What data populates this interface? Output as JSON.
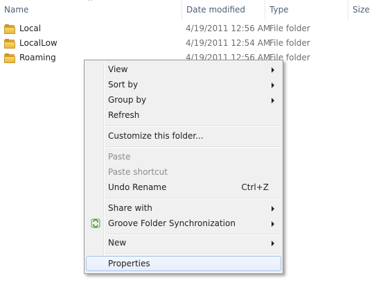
{
  "columns": {
    "name": "Name",
    "date_modified": "Date modified",
    "type": "Type",
    "size": "Size",
    "sort_indicator": "^"
  },
  "files": [
    {
      "name": "Local",
      "date_modified": "4/19/2011 12:56 AM",
      "type": "File folder",
      "icon": "folder-icon"
    },
    {
      "name": "LocalLow",
      "date_modified": "4/19/2011 12:54 AM",
      "type": "File folder",
      "icon": "folder-icon"
    },
    {
      "name": "Roaming",
      "date_modified": "4/19/2011 12:56 AM",
      "type": "File folder",
      "icon": "folder-icon"
    }
  ],
  "context_menu": {
    "items": [
      {
        "label": "View",
        "submenu": true,
        "disabled": false
      },
      {
        "label": "Sort by",
        "submenu": true,
        "disabled": false
      },
      {
        "label": "Group by",
        "submenu": true,
        "disabled": false
      },
      {
        "label": "Refresh",
        "submenu": false,
        "disabled": false
      },
      {
        "label": "Customize this folder...",
        "submenu": false,
        "disabled": false
      },
      {
        "label": "Paste",
        "submenu": false,
        "disabled": true
      },
      {
        "label": "Paste shortcut",
        "submenu": false,
        "disabled": true
      },
      {
        "label": "Undo Rename",
        "shortcut": "Ctrl+Z",
        "submenu": false,
        "disabled": false
      },
      {
        "label": "Share with",
        "submenu": true,
        "disabled": false
      },
      {
        "label": "Groove Folder Synchronization",
        "submenu": true,
        "disabled": false,
        "icon": "groove-sync-icon"
      },
      {
        "label": "New",
        "submenu": true,
        "disabled": false
      },
      {
        "label": "Properties",
        "submenu": false,
        "disabled": false,
        "highlighted": true
      }
    ]
  },
  "colors": {
    "header_text": "#4c607a",
    "menu_background": "#f0f0f0",
    "highlight_border": "#a8c2e6",
    "folder_yellow": "#e8b840"
  }
}
